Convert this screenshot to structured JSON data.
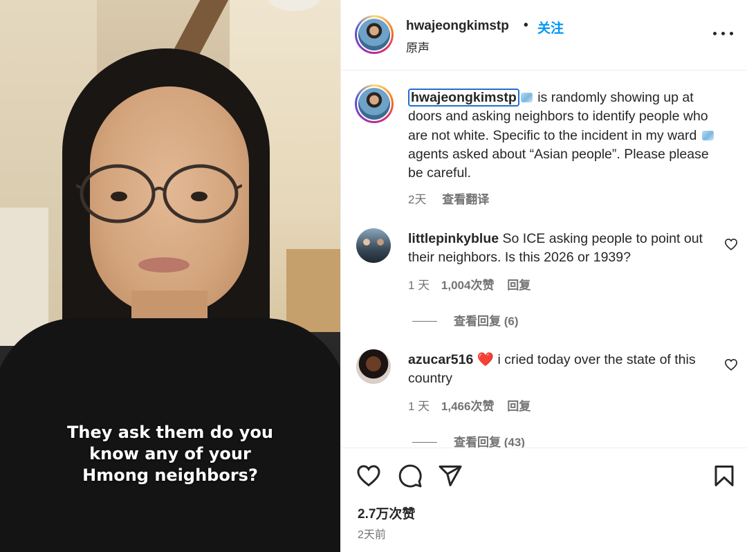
{
  "video": {
    "caption_lines": [
      "They ask them do you",
      "know any of your",
      "Hmong neighbors?"
    ]
  },
  "header": {
    "username": "hwajeongkimstp",
    "separator": "•",
    "follow_label": "关注",
    "audio_label": "原声",
    "more_icon": "more-horizontal-icon"
  },
  "caption": {
    "username": "hwajeongkimstp",
    "text_part1": " is randomly showing up at doors and asking neighbors to identify people who are not white. Specific to the incident in my ward ",
    "text_part2": " agents asked about “Asian people”. Please please be careful.",
    "emoji_icon": "ice-cube-icon",
    "time": "2天",
    "translate_label": "查看翻译"
  },
  "comments": [
    {
      "username": "littlepinkyblue",
      "text": " So ICE asking people to point out their neighbors. Is this 2026 or 1939?",
      "time": "1 天",
      "likes": "1,004次赞",
      "reply_label": "回复",
      "view_replies": "查看回复 (6)"
    },
    {
      "username": "azucar516",
      "emoji": "❤️",
      "text": " i cried today over the state of this country",
      "time": "1 天",
      "likes": "1,466次赞",
      "reply_label": "回复",
      "view_replies": "查看回复 (43)"
    }
  ],
  "footer": {
    "likes": "2.7万次赞",
    "posted": "2天前",
    "icons": [
      "heart-icon",
      "comment-icon",
      "share-icon",
      "bookmark-icon"
    ]
  },
  "colors": {
    "accent": "#0095f6",
    "text": "#262626",
    "secondary": "#737373",
    "mention_outline": "#1f6fd1"
  }
}
